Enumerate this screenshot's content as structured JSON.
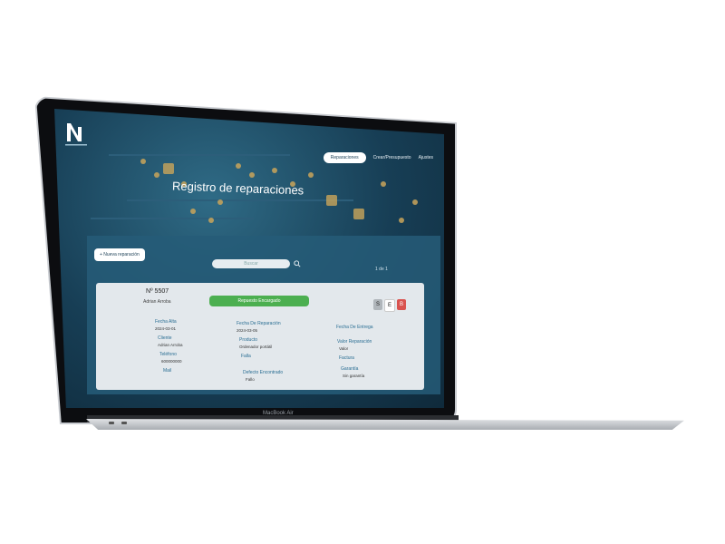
{
  "nav": {
    "active": "Reparaciones",
    "items": [
      "Reparaciones",
      "Crear/Presupuesto",
      "Ajustes"
    ]
  },
  "hero": {
    "title": "Registro de reparaciones"
  },
  "toolbar": {
    "new_label": "+ Nueva reparación",
    "search_placeholder": "Buscar",
    "counter": "1 de 1"
  },
  "repair": {
    "number": "Nº 5507",
    "client": "Adrian Arroba",
    "status": "Repuesto Encargado",
    "actions": [
      "S",
      "E",
      "B"
    ],
    "fields": {
      "fecha_alta": {
        "label": "Fecha Alta",
        "value": "2024-03-01"
      },
      "cliente": {
        "label": "Cliente",
        "value": "Adrian Arroba"
      },
      "telefono": {
        "label": "Teléfono",
        "value": "600000000"
      },
      "mail": {
        "label": "Mail",
        "value": ""
      },
      "fecha_reparacion": {
        "label": "Fecha De Reparación",
        "value": "2024-03-05"
      },
      "producto": {
        "label": "Producto",
        "value": "Ordenador portátil"
      },
      "falla": {
        "label": "Falla",
        "value": ""
      },
      "defecto": {
        "label": "Defecto Encontrado",
        "value": "Fallo"
      },
      "fecha_entrega": {
        "label": "Fecha De Entrega",
        "value": ""
      },
      "valor": {
        "label": "Valor Reparación",
        "value": "Valor"
      },
      "factura": {
        "label": "Factura",
        "value": ""
      },
      "garantia": {
        "label": "Garantía",
        "value": "Sin garantía"
      }
    }
  },
  "laptop": {
    "brand": "MacBook Air"
  }
}
